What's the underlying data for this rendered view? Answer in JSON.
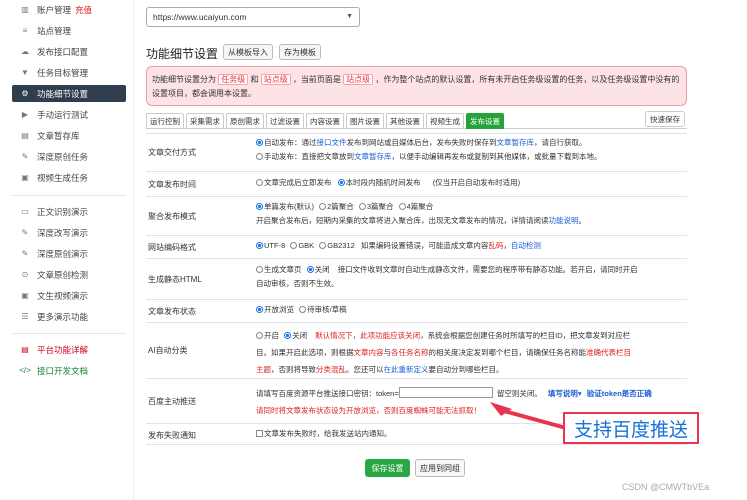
{
  "sidebar": {
    "items": [
      {
        "label": "账户管理",
        "extra": "充值",
        "icon": "chart-icon"
      },
      {
        "label": "站点管理",
        "icon": "database-icon"
      },
      {
        "label": "发布接口配置",
        "icon": "cloud-upload-icon"
      },
      {
        "label": "任务目标管理",
        "icon": "filter-icon"
      },
      {
        "label": "功能细节设置",
        "icon": "cogs-icon"
      },
      {
        "label": "手动运行测试",
        "icon": "play-icon"
      },
      {
        "label": "文章暂存库",
        "icon": "file-icon"
      },
      {
        "label": "深度原创任务",
        "icon": "edit-icon"
      },
      {
        "label": "视频生成任务",
        "icon": "video-icon"
      },
      {
        "label": "正文识别演示",
        "icon": "monitor-icon"
      },
      {
        "label": "深度改写演示",
        "icon": "edit-icon"
      },
      {
        "label": "深度原创演示",
        "icon": "edit-icon"
      },
      {
        "label": "文章原创检测",
        "icon": "search-icon"
      },
      {
        "label": "文生视频演示",
        "icon": "video-icon"
      },
      {
        "label": "更多演示功能",
        "icon": "list-icon"
      },
      {
        "label": "平台功能详解",
        "icon": "book-icon"
      },
      {
        "label": "接口开发文档",
        "icon": "code-icon"
      }
    ]
  },
  "main": {
    "site_select": "https://www.ucaiyun.com",
    "title": "功能细节设置",
    "import_btn": "从模板导入",
    "save_tpl_btn": "存为模板",
    "notice": {
      "p1": "功能细节设置分为",
      "tag1": "任务级",
      "p2": "和",
      "tag2": "站点级",
      "p3": "，当前页面是",
      "tag3": "站点级",
      "p4": "，作为整个站点的默认设置，所有未开启任务级设置的任务，以及任务级设置中没有的设置项目，都会调用本设置。"
    },
    "tabs": [
      "运行控制",
      "采集需求",
      "原创需求",
      "过滤设置",
      "内容设置",
      "图片设置",
      "其他设置",
      "视频生成",
      "发布设置"
    ],
    "quick_save": "快速保存",
    "rows": {
      "deliver": {
        "label": "文章交付方式",
        "a1": "自动发布：通过",
        "a_link": "接口文件",
        "a2": "发布到网站或自媒体后台，发布失败时保存到",
        "a_link2": "文章暂存库",
        "a3": "，请自行获取。",
        "b1": "手动发布：直接把文章放到",
        "b_link": "文章暂存库",
        "b2": "，以便手动编辑再发布或复制到其他媒体，或批量下载到本地。"
      },
      "time": {
        "label": "文章发布时间",
        "o1": "文章完成后立即发布",
        "o2": "本时段内随机时间发布",
        "note": "(仅当开启自动发布时适用)"
      },
      "aggregate": {
        "label": "聚合发布模式",
        "o1": "单篇发布(默认)",
        "o2": "2篇聚合",
        "o3": "3篇聚合",
        "o4": "4篇聚合",
        "desc": "开启聚合发布后，短期内采集的文章将进入聚合库，出现无文章发布的情况，详情请阅读",
        "desc_link": "功能说明",
        "desc_end": "。"
      },
      "encoding": {
        "label": "网站编码格式",
        "o1": "UTF-8",
        "o2": "GBK",
        "o3": "GB2312",
        "n1": "如果编码设置错误，可能造成文章内容",
        "n_red": "乱码",
        "n2": "，",
        "n_link": "自动检测"
      },
      "static": {
        "label": "生成静态HTML",
        "o1": "生成文章页",
        "o2": "关闭",
        "l1": "接口文件收到文章时自动生成静态文件，需要您的程序带有静态功能。若开启，请同时开启",
        "l2": "自动审核，否则不生效。"
      },
      "status": {
        "label": "文章发布状态",
        "o1": "开放浏览",
        "o2": "待审核/草稿"
      },
      "classify": {
        "label": "AI自动分类",
        "o1": "开启",
        "o2": "关闭",
        "r1a": "默认情况下，此项功能应该关闭",
        "r1b": "，系统会根据您创建任务时所填写的栏目ID，把文章发到对应栏",
        "r2a": "目。如果开启此选项，则根据",
        "r2b": "文章内容",
        "r2c": "与",
        "r2d": "各任务名称",
        "r2e": "的相关度决定发到哪个栏目，请确保任务名称能",
        "r2f": "准确代表栏目",
        "r3a": "主题",
        "r3b": "，否则将导致",
        "r3c": "分类混乱",
        "r3d": "。您还可以",
        "r3e": "在此重新定义",
        "r3f": "要自动分到哪些栏目。"
      },
      "baidu": {
        "label": "百度主动推送",
        "l1a": "请填写百度资源平台推送接口密钥：token=",
        "l1b": "留空则关闭。",
        "l1c": "填写说明",
        "l1d": "验证token是否正确",
        "l2": "请同时将文章发布状态设为开放浏览，否则百度蜘蛛可能无法抓取！"
      },
      "notify": {
        "label": "发布失败通知",
        "o1": "文章发布失败时，给我发送站内通知。"
      }
    },
    "save_btn": "保存设置",
    "apply_btn": "应用到同组"
  },
  "annotation": {
    "callout": "支持百度推送",
    "arrow_color": "#e8354f"
  },
  "watermark": "CSDN @CMWTbVEa"
}
